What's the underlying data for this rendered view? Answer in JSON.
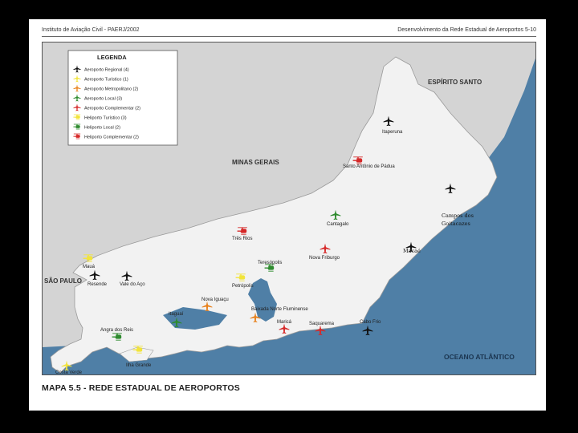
{
  "header": {
    "left": "Instituto de Aviação Civil - PAERJ/2002",
    "right": "Desenvolvimento da Rede Estadual de Aeroportos  5-10"
  },
  "caption": "MAPA 5.5 - REDE ESTADUAL DE AEROPORTOS",
  "legend": {
    "title": "LEGENDA",
    "items": [
      {
        "label": "Aeroporto Regional (4)",
        "icon": "plane-icon",
        "color": "#111111"
      },
      {
        "label": "Aeroporto Turístico (1)",
        "icon": "plane-icon",
        "color": "#f2e43a"
      },
      {
        "label": "Aeroporto Metropolitano (2)",
        "icon": "plane-icon",
        "color": "#e8821e"
      },
      {
        "label": "Aeroporto Local (3)",
        "icon": "plane-icon",
        "color": "#2e8b2e"
      },
      {
        "label": "Aeroporto Complementar (2)",
        "icon": "plane-icon",
        "color": "#d62828"
      },
      {
        "label": "Heliporto Turístico (3)",
        "icon": "helicopter-icon",
        "color": "#f2e43a"
      },
      {
        "label": "Heliporto Local (2)",
        "icon": "helicopter-icon",
        "color": "#2e8b2e"
      },
      {
        "label": "Heliporto Complementar (2)",
        "icon": "helicopter-icon",
        "color": "#d62828"
      }
    ]
  },
  "regions": {
    "espirito_santo": "ESPÍRITO SANTO",
    "minas_gerais": "MINAS GERAIS",
    "sao_paulo": "SÃO PAULO",
    "oceano": "OCEANO ATLÂNTICO"
  },
  "places": {
    "itaperuna": "Itaperuna",
    "santo_antonio": "Santo Antônio de Pádua",
    "campos_1": "Campos dos",
    "campos_2": "Goitacazes",
    "macae": "Macaé",
    "cantagalo": "Cantagalo",
    "tres_rios": "Três Rios",
    "nova_friburgo": "Nova Friburgo",
    "teresopolis": "Teresópolis",
    "maua": "Mauá",
    "resende": "Resende",
    "vale_aco": "Vale do Aço",
    "petropolis": "Petrópolis",
    "nova_iguacu": "Nova Iguaçu",
    "baixada": "Baixada Norte Fluminense",
    "itaguai": "Itaguaí",
    "marica": "Maricá",
    "saquarema": "Saquarema",
    "cabo_frio": "Cabo Frio",
    "angra": "Angra dos Reis",
    "ilha_grande": "Ilha Grande",
    "costa_verde": "Costa Verde"
  },
  "colors": {
    "land": "#d4d4d4",
    "state": "#f2f2f2",
    "sea": "#4f7fa6",
    "regional": "#111111",
    "turistico": "#f2e43a",
    "metropolitano": "#e8821e",
    "local": "#2e8b2e",
    "complementar": "#d62828"
  }
}
